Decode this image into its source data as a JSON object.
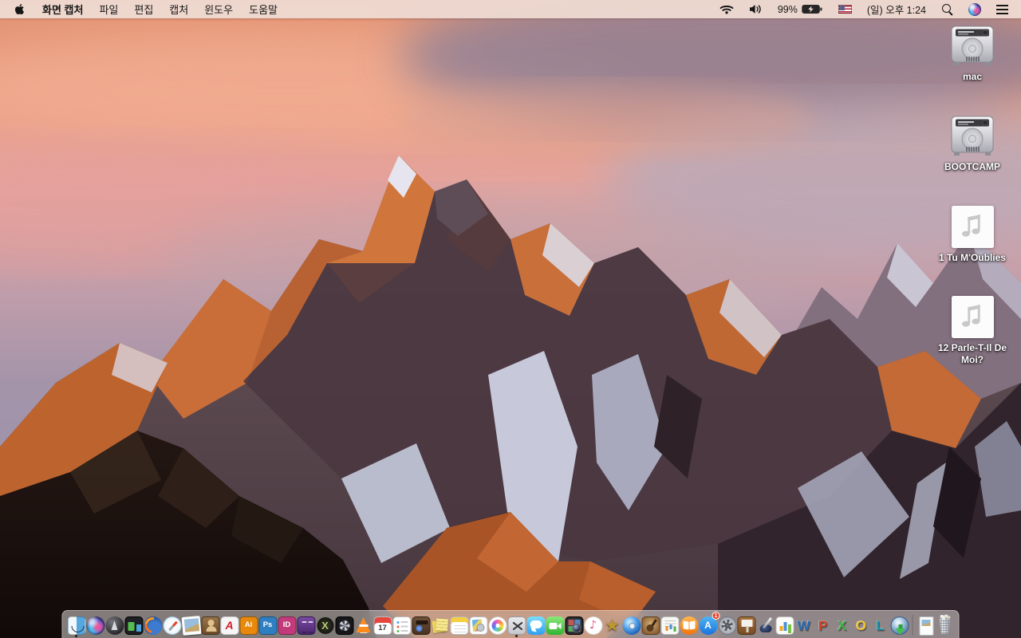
{
  "menu_bar": {
    "app_name": "화면 캡처",
    "menus": [
      "파일",
      "편집",
      "캡처",
      "윈도우",
      "도움말"
    ],
    "status": {
      "battery_percent": "99%",
      "clock": "(일) 오후 1:24",
      "icons": [
        "wifi-icon",
        "volume-icon",
        "battery-charging-icon",
        "us-flag-icon",
        "spotlight-icon",
        "siri-icon",
        "notification-center-icon"
      ]
    }
  },
  "desktop": {
    "icons": [
      {
        "name": "mac",
        "kind": "hard-drive",
        "label": "mac"
      },
      {
        "name": "bootcamp",
        "kind": "hard-drive",
        "label": "BOOTCAMP"
      },
      {
        "name": "audio-file-1",
        "kind": "audio-file",
        "label": "1 Tu M'Oublies"
      },
      {
        "name": "audio-file-12",
        "kind": "audio-file",
        "label": "12 Parle-T-Il De Moi?"
      }
    ]
  },
  "dock": {
    "items": [
      {
        "name": "finder",
        "type": "finder",
        "running": true
      },
      {
        "name": "siri",
        "type": "siri"
      },
      {
        "name": "launchpad",
        "type": "launchpad"
      },
      {
        "name": "window-tiles-app",
        "type": "tiles"
      },
      {
        "name": "firefox",
        "type": "firefox"
      },
      {
        "name": "safari",
        "type": "safari"
      },
      {
        "name": "preview",
        "type": "photo"
      },
      {
        "name": "contacts",
        "type": "contacts"
      },
      {
        "name": "acrobat-reader",
        "type": "acrobat",
        "glyph": "A"
      },
      {
        "name": "illustrator",
        "type": "tile",
        "glyph": "Ai",
        "bg": "#e8890c",
        "fg": "#ffffff"
      },
      {
        "name": "photoshop",
        "type": "tile",
        "glyph": "Ps",
        "bg": "#2e7fc2",
        "fg": "#ffffff"
      },
      {
        "name": "indesign",
        "type": "tile",
        "glyph": "ID",
        "bg": "#c23a7a",
        "fg": "#ffffff"
      },
      {
        "name": "toast-titanium",
        "type": "toast"
      },
      {
        "name": "x-media-app",
        "type": "xee",
        "glyph": "X"
      },
      {
        "name": "turbo-encoder-app",
        "type": "turbo"
      },
      {
        "name": "vlc",
        "type": "vlc"
      },
      {
        "name": "calendar",
        "type": "calendar",
        "glyph": "17"
      },
      {
        "name": "reminders",
        "type": "reminders"
      },
      {
        "name": "print-box-app",
        "type": "printbox"
      },
      {
        "name": "stickies",
        "type": "stickies"
      },
      {
        "name": "notes",
        "type": "notes"
      },
      {
        "name": "print-shop-app",
        "type": "printshop"
      },
      {
        "name": "photos",
        "type": "photos"
      },
      {
        "name": "grab-screen-capture",
        "type": "grab",
        "running": true
      },
      {
        "name": "messages",
        "type": "messages"
      },
      {
        "name": "facetime",
        "type": "facetime"
      },
      {
        "name": "photo-booth",
        "type": "photobooth"
      },
      {
        "name": "itunes",
        "type": "itunes",
        "glyph": "♪"
      },
      {
        "name": "imovie",
        "type": "imovie",
        "glyph": "★"
      },
      {
        "name": "dvd-player",
        "type": "dvd"
      },
      {
        "name": "garageband",
        "type": "garageband"
      },
      {
        "name": "documents-stack-app",
        "type": "docs"
      },
      {
        "name": "ibooks",
        "type": "ibooks"
      },
      {
        "name": "app-store",
        "type": "appstore",
        "glyph": "A",
        "badge": "1"
      },
      {
        "name": "system-preferences",
        "type": "prefs"
      },
      {
        "name": "keynote",
        "type": "keynote"
      },
      {
        "name": "pages",
        "type": "pages"
      },
      {
        "name": "numbers",
        "type": "numbers"
      },
      {
        "name": "word",
        "type": "letter",
        "glyph": "W",
        "color": "#2b6bb2"
      },
      {
        "name": "powerpoint",
        "type": "letter",
        "glyph": "P",
        "color": "#d24625"
      },
      {
        "name": "excel",
        "type": "letter",
        "glyph": "X",
        "color": "#3faf46"
      },
      {
        "name": "outlook",
        "type": "letter",
        "glyph": "O",
        "color": "#eec531"
      },
      {
        "name": "lync",
        "type": "letter",
        "glyph": "L",
        "color": "#1397ab"
      },
      {
        "name": "web-download-app",
        "type": "globe"
      },
      {
        "name": "dock-divider",
        "type": "divider"
      },
      {
        "name": "document-file",
        "type": "docfile"
      },
      {
        "name": "trash-full",
        "type": "trash"
      }
    ]
  },
  "colors": {
    "menu_bar_bg": "#eedad2",
    "dock_bg": "rgba(222,216,213,0.55)",
    "sunlit_rock": "#c56a3a",
    "sky_top": "#e29272",
    "badge_red": "#e8402a"
  }
}
